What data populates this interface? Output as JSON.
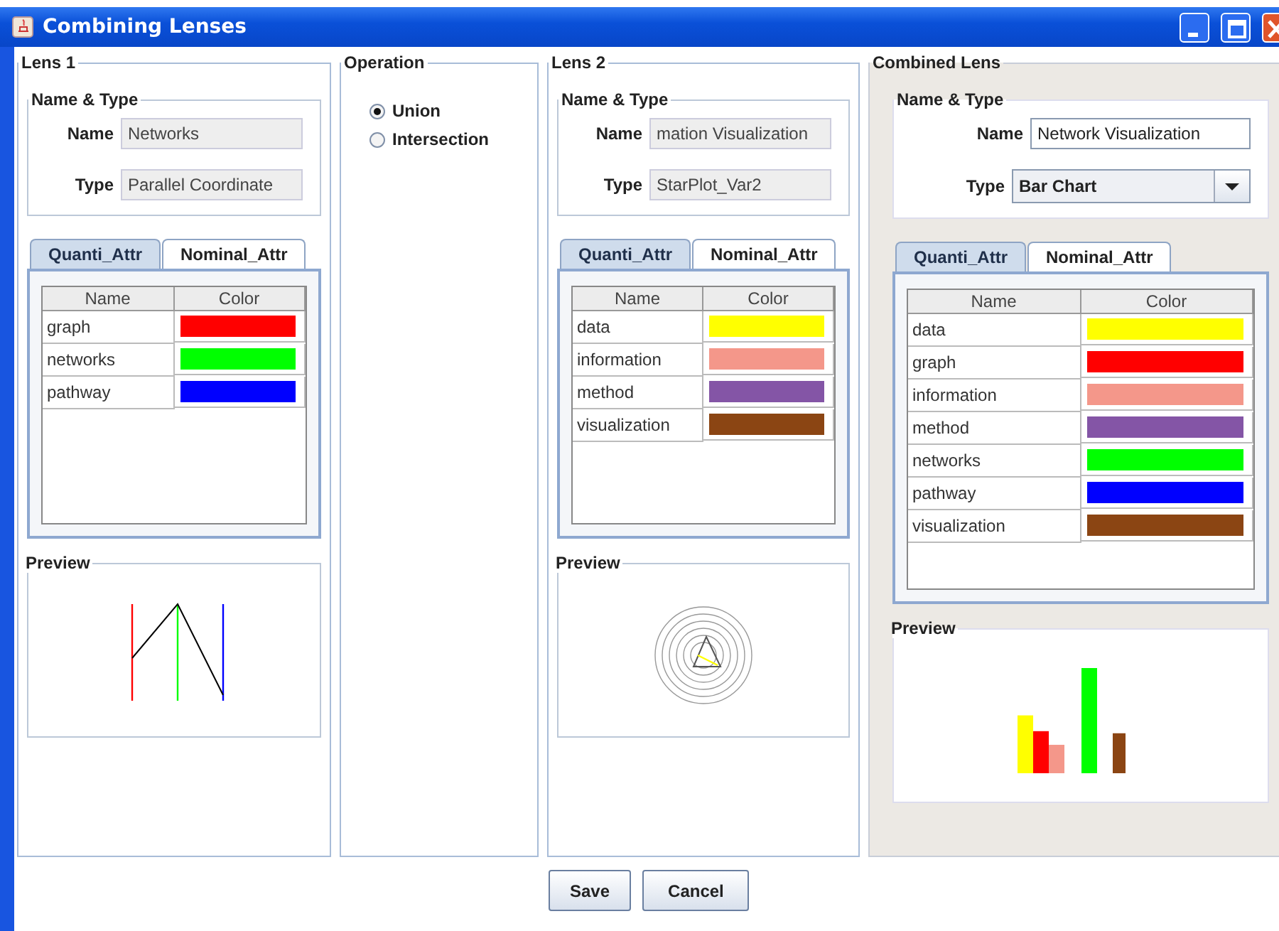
{
  "window": {
    "title": "Combining Lenses"
  },
  "lenses": [
    {
      "title": "Lens 1",
      "group_title": "Name & Type",
      "name_label": "Name",
      "name_value": "Networks",
      "type_label": "Type",
      "type_value": "Parallel Coordinate",
      "editable": false,
      "tabs": [
        {
          "label": "Quanti_Attr",
          "selected": true
        },
        {
          "label": "Nominal_Attr",
          "selected": false
        }
      ],
      "columns": [
        "Name",
        "Color"
      ],
      "rows": [
        {
          "name": "graph",
          "color": "#ff0000"
        },
        {
          "name": "networks",
          "color": "#00ff00"
        },
        {
          "name": "pathway",
          "color": "#0000ff"
        }
      ],
      "preview": {
        "title": "Preview",
        "kind": "parallel"
      }
    },
    {
      "title": "Lens 2",
      "group_title": "Name & Type",
      "name_label": "Name",
      "name_value": "mation Visualization",
      "type_label": "Type",
      "type_value": "StarPlot_Var2",
      "editable": false,
      "tabs": [
        {
          "label": "Quanti_Attr",
          "selected": true
        },
        {
          "label": "Nominal_Attr",
          "selected": false
        }
      ],
      "columns": [
        "Name",
        "Color"
      ],
      "rows": [
        {
          "name": "data",
          "color": "#ffff00"
        },
        {
          "name": "information",
          "color": "#f4978a"
        },
        {
          "name": "method",
          "color": "#8455a6"
        },
        {
          "name": "visualization",
          "color": "#8b4513"
        }
      ],
      "preview": {
        "title": "Preview",
        "kind": "star"
      }
    }
  ],
  "operation": {
    "title": "Operation",
    "options": [
      {
        "label": "Union",
        "selected": true
      },
      {
        "label": "Intersection",
        "selected": false
      }
    ]
  },
  "combined": {
    "title": "Combined Lens",
    "group_title": "Name & Type",
    "name_label": "Name",
    "name_value": "Network Visualization",
    "type_label": "Type",
    "type_value": "Bar Chart",
    "editable": true,
    "tabs": [
      {
        "label": "Quanti_Attr",
        "selected": true
      },
      {
        "label": "Nominal_Attr",
        "selected": false
      }
    ],
    "columns": [
      "Name",
      "Color"
    ],
    "rows": [
      {
        "name": "data",
        "color": "#ffff00"
      },
      {
        "name": "graph",
        "color": "#ff0000"
      },
      {
        "name": "information",
        "color": "#f4978a"
      },
      {
        "name": "method",
        "color": "#8455a6"
      },
      {
        "name": "networks",
        "color": "#00ff00"
      },
      {
        "name": "pathway",
        "color": "#0000ff"
      },
      {
        "name": "visualization",
        "color": "#8b4513"
      }
    ],
    "preview": {
      "title": "Preview",
      "kind": "bar"
    }
  },
  "buttons": [
    "Save",
    "Cancel"
  ]
}
